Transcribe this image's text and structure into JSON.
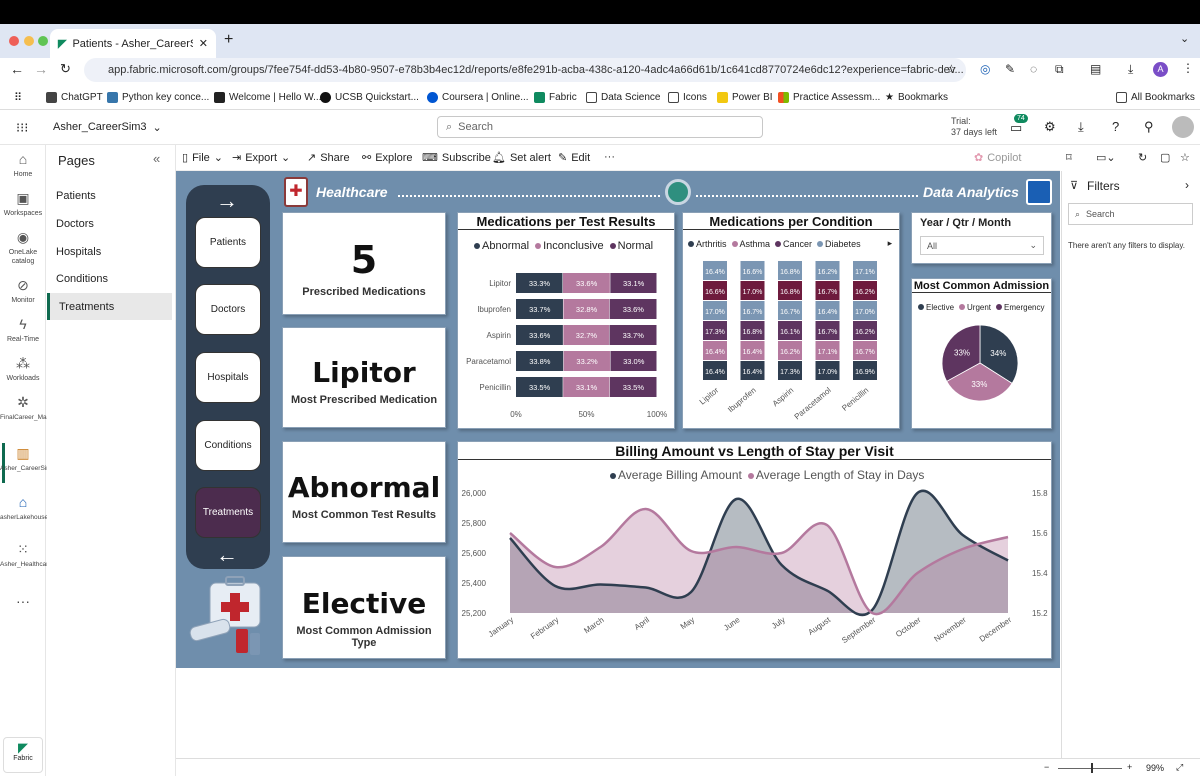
{
  "browser": {
    "tab_title": "Patients - Asher_CareerSim3",
    "url": "app.fabric.microsoft.com/groups/7fee754f-dd53-4b80-9507-e78b3b4ec12d/reports/e8fe291b-acba-438c-a120-4adc4a66d61b/1c641cd8770724e6dc12?experience=fabric-dev...",
    "avatar_letter": "A",
    "bookmarks": [
      "ChatGPT",
      "Python key conce...",
      "Welcome | Hello W...",
      "UCSB Quickstart...",
      "Coursera | Online...",
      "Fabric",
      "Data Science",
      "Icons",
      "Power BI",
      "Practice Assessm...",
      "Bookmarks"
    ],
    "all_bookmarks": "All Bookmarks"
  },
  "fabric": {
    "workspace": "Asher_CareerSim3",
    "search_placeholder": "Search",
    "trial_line1": "Trial:",
    "trial_line2": "37 days left",
    "notif_count": "74",
    "rail": [
      {
        "label": "Home",
        "icon": "home-icon",
        "glyph": "⌂"
      },
      {
        "label": "Workspaces",
        "icon": "workspaces-icon",
        "glyph": "▣"
      },
      {
        "label": "OneLake catalog",
        "icon": "onelake-icon",
        "glyph": "◉"
      },
      {
        "label": "Monitor",
        "icon": "monitor-icon",
        "glyph": "⊘"
      },
      {
        "label": "Real-Time",
        "icon": "realtime-icon",
        "glyph": "ϟ"
      },
      {
        "label": "Workloads",
        "icon": "workloads-icon",
        "glyph": "⁂"
      },
      {
        "label": "FinalCareer_March202...",
        "icon": "workspace-item-icon",
        "glyph": "✲"
      },
      {
        "label": "Asher_CareerSim3",
        "icon": "report-icon",
        "glyph": "▥"
      },
      {
        "label": "asherLakehouse",
        "icon": "lakehouse-icon",
        "glyph": "⌂"
      },
      {
        "label": "Asher_Healthcare_SM",
        "icon": "semantic-model-icon",
        "glyph": "⁙"
      }
    ],
    "fabric_label": "Fabric"
  },
  "pages_panel": {
    "title": "Pages",
    "items": [
      "Patients",
      "Doctors",
      "Hospitals",
      "Conditions",
      "Treatments"
    ],
    "active": "Treatments"
  },
  "toolbar": {
    "file": "File",
    "export": "Export",
    "share": "Share",
    "explore": "Explore",
    "subscribe": "Subscribe",
    "set_alert": "Set alert",
    "edit": "Edit",
    "copilot": "Copilot"
  },
  "filters": {
    "title": "Filters",
    "search_placeholder": "Search",
    "empty_text": "There aren't any filters to display."
  },
  "status": {
    "zoom": "99%"
  },
  "report": {
    "header_left": "Healthcare",
    "header_right": "Data Analytics",
    "nav_buttons": [
      "Patients",
      "Doctors",
      "Hospitals",
      "Conditions",
      "Treatments"
    ],
    "kpis": [
      {
        "value": "5",
        "label": "Prescribed Medications"
      },
      {
        "value": "Lipitor",
        "label": "Most Prescribed Medication"
      },
      {
        "value": "Abnormal",
        "label": "Most Common Test Results"
      },
      {
        "value": "Elective",
        "label": "Most Common Admission Type"
      }
    ],
    "slicer": {
      "title": "Year / Qtr / Month",
      "value": "All"
    },
    "colors": {
      "dark": "#2f3e50",
      "pink": "#b4799e",
      "purple": "#5e3560",
      "blue": "#7b96b3",
      "maroon": "#6e1b3d",
      "header_bg": "#6f8eac"
    }
  },
  "chart_data": [
    {
      "type": "bar",
      "title": "Medications per Test Results",
      "stacked": "100%",
      "orientation": "horizontal",
      "categories": [
        "Lipitor",
        "Ibuprofen",
        "Aspirin",
        "Paracetamol",
        "Penicillin"
      ],
      "series": [
        {
          "name": "Abnormal",
          "color": "#2f3e50",
          "values": [
            33.3,
            33.7,
            33.6,
            33.8,
            33.5
          ]
        },
        {
          "name": "Inconclusive",
          "color": "#b4799e",
          "values": [
            33.6,
            32.8,
            32.7,
            33.2,
            33.1
          ]
        },
        {
          "name": "Normal",
          "color": "#5e3560",
          "values": [
            33.1,
            33.6,
            33.7,
            33.0,
            33.5
          ]
        }
      ],
      "x_ticks": [
        "0%",
        "50%",
        "100%"
      ],
      "legend": "top"
    },
    {
      "type": "bar",
      "title": "Medications per Condition",
      "stacked": "100%",
      "orientation": "vertical",
      "categories": [
        "Lipitor",
        "Ibuprofen",
        "Aspirin",
        "Paracetamol",
        "Penicillin"
      ],
      "legend_names": [
        "Arthritis",
        "Asthma",
        "Cancer",
        "Diabetes"
      ],
      "legend_colors": [
        "#2f3e50",
        "#b4799e",
        "#5e3560",
        "#7b96b3"
      ],
      "segment_color_cycle": [
        "#7b96b3",
        "#6e1b3d",
        "#7b96b3",
        "#5e3560",
        "#b4799e",
        "#2f3e50"
      ],
      "columns": [
        [
          "16.4%",
          "16.6%",
          "17.0%",
          "17.3%",
          "16.4%",
          "16.4%"
        ],
        [
          "16.6%",
          "17.0%",
          "16.7%",
          "16.8%",
          "16.4%",
          "16.4%"
        ],
        [
          "16.8%",
          "16.8%",
          "16.7%",
          "16.1%",
          "16.2%",
          "17.3%"
        ],
        [
          "16.2%",
          "16.7%",
          "16.4%",
          "16.7%",
          "17.1%",
          "17.0%"
        ],
        [
          "17.1%",
          "16.2%",
          "17.0%",
          "16.2%",
          "16.7%",
          "16.9%"
        ]
      ],
      "legend": "top"
    },
    {
      "type": "pie",
      "title": "Most Common Admission",
      "labels": [
        "Elective",
        "Urgent",
        "Emergency"
      ],
      "values": [
        34,
        33,
        33
      ],
      "colors": [
        "#2f3e50",
        "#b4799e",
        "#5e3560"
      ],
      "slice_labels": [
        "34%",
        "33%",
        "33%"
      ],
      "legend": "top"
    },
    {
      "type": "area",
      "title": "Billing Amount vs Length of Stay per Visit",
      "categories": [
        "January",
        "February",
        "March",
        "April",
        "May",
        "June",
        "July",
        "August",
        "September",
        "October",
        "November",
        "December"
      ],
      "series": [
        {
          "name": "Average Billing Amount",
          "axis": "left",
          "color": "#2f3e50",
          "values": [
            25700,
            25380,
            25390,
            25370,
            25340,
            25960,
            25520,
            25350,
            25220,
            26000,
            25720,
            25550
          ]
        },
        {
          "name": "Average Length of Stay in Days",
          "axis": "right",
          "color": "#b4799e",
          "values": [
            15.6,
            15.43,
            15.53,
            15.72,
            15.51,
            15.53,
            15.5,
            15.64,
            15.2,
            15.4,
            15.52,
            15.58
          ]
        }
      ],
      "y_left": {
        "ticks": [
          "25,200",
          "25,400",
          "25,600",
          "25,800",
          "26,000"
        ],
        "min": 25200,
        "max": 26000
      },
      "y_right": {
        "ticks": [
          "15.2",
          "15.4",
          "15.6",
          "15.8"
        ],
        "min": 15.2,
        "max": 15.8
      },
      "legend": "top"
    }
  ]
}
